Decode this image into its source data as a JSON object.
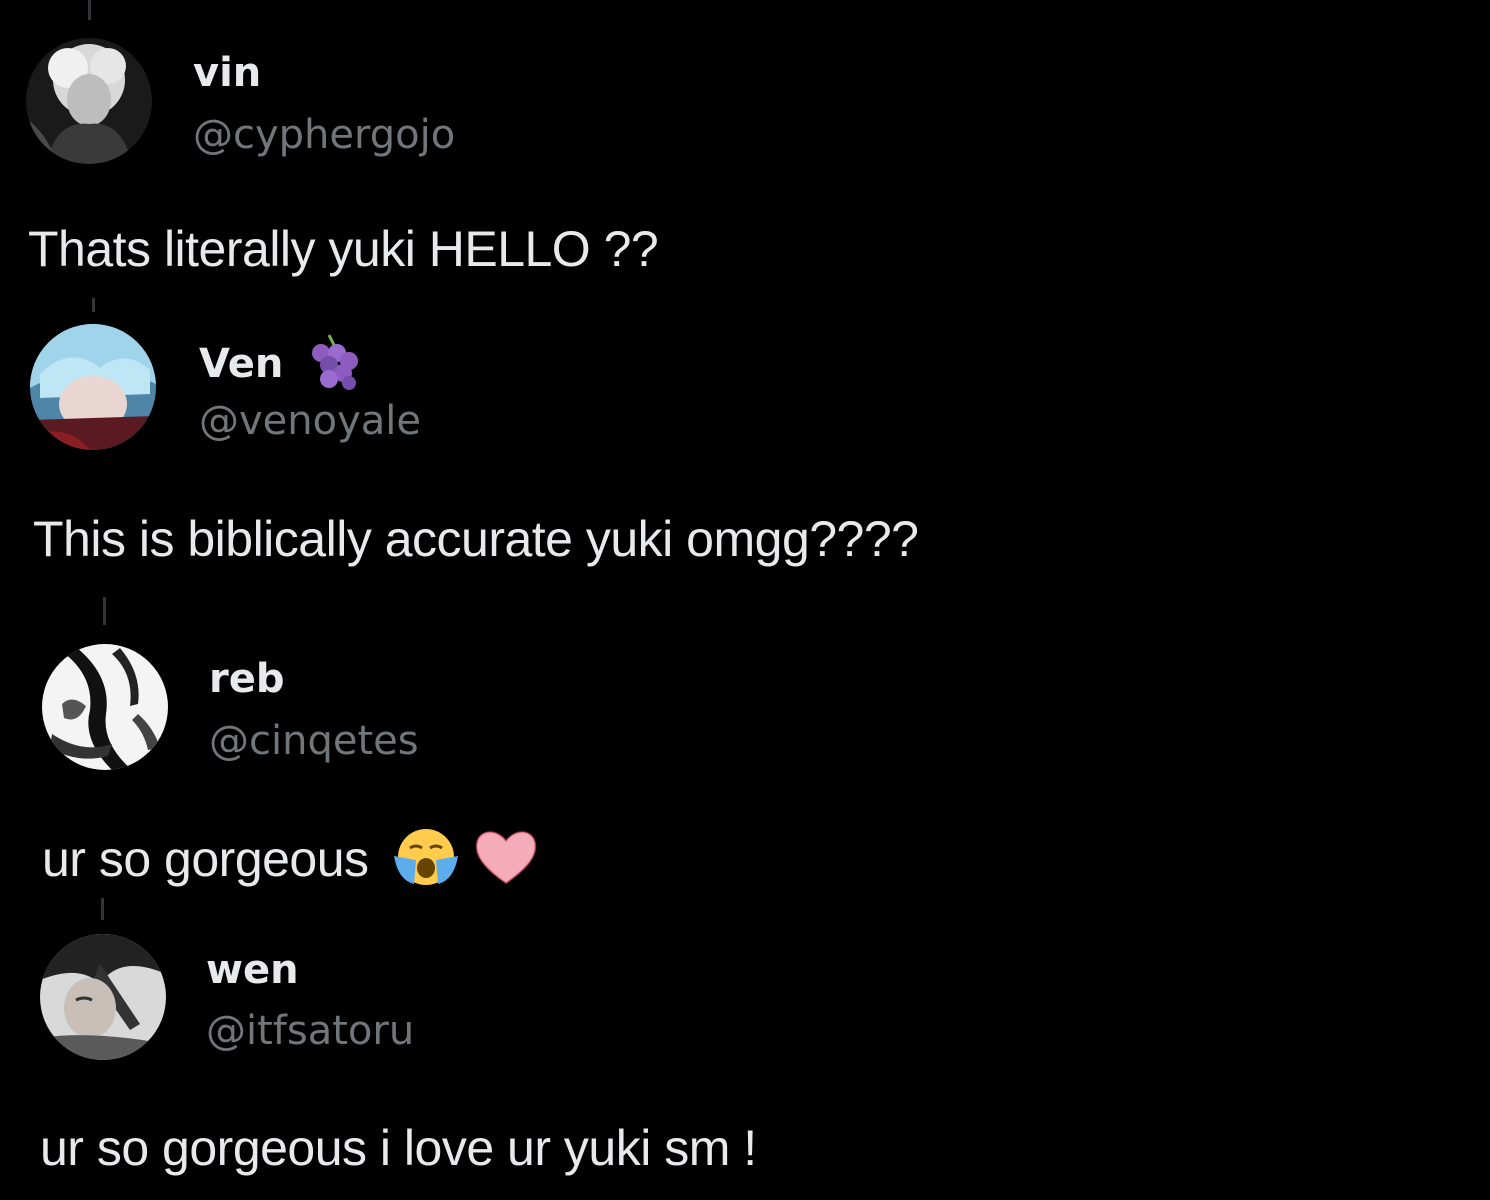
{
  "replies": [
    {
      "display_name": "vin",
      "handle": "@cyphergojo",
      "text": "Thats literally yuki HELLO ??",
      "avatar": "avatar-white-haired-character"
    },
    {
      "display_name": "Ven",
      "name_emoji": "grapes-emoji",
      "handle": "@venoyale",
      "text": "This is biblically accurate yuki omgg????",
      "avatar": "avatar-blue-haired-character"
    },
    {
      "display_name": "reb",
      "handle": "@cinqetes",
      "text": "ur so gorgeous",
      "text_emojis": [
        "loudly-crying-face-emoji",
        "pink-heart-emoji"
      ],
      "avatar": "avatar-manga-sketch"
    },
    {
      "display_name": "wen",
      "handle": "@itfsatoru",
      "text": "ur so gorgeous i love ur yuki sm !",
      "avatar": "avatar-dark-haired-character"
    }
  ],
  "colors": {
    "background": "#000000",
    "primary_text": "#e7e9ea",
    "secondary_text": "#71767b",
    "thread_line": "#333639"
  }
}
